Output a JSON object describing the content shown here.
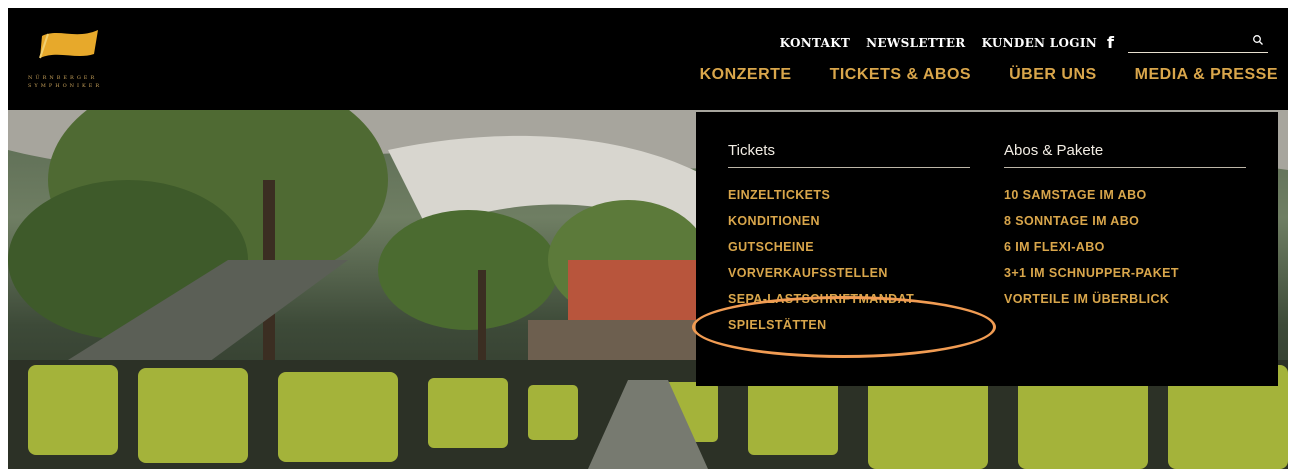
{
  "logo": {
    "text_line1": "NÜRNBERGER",
    "text_line2": "SYMPHONIKER",
    "icon": "flag-logo"
  },
  "top_links": {
    "kontakt": "KONTAKT",
    "newsletter": "NEWSLETTER",
    "kunden_login": "KUNDEN LOGIN",
    "facebook": "f"
  },
  "search": {
    "placeholder": "",
    "icon": "search-icon"
  },
  "main_nav": {
    "konzerte": "KONZERTE",
    "tickets_abos": "TICKETS & ABOS",
    "ueber_uns": "ÜBER UNS",
    "media_presse": "MEDIA & PRESSE"
  },
  "dropdown": {
    "tickets": {
      "heading": "Tickets",
      "items": [
        "EINZELTICKETS",
        "KONDITIONEN",
        "GUTSCHEINE",
        "VORVERKAUFSSTELLEN",
        "SEPA-LASTSCHRIFTMANDAT",
        "SPIELSTÄTTEN"
      ]
    },
    "abos": {
      "heading": "Abos & Pakete",
      "items": [
        "10 SAMSTAGE IM ABO",
        "8 SONNTAGE IM ABO",
        "6 IM FLEXI-ABO",
        "3+1 IM SCHNUPPER-PAKET",
        "VORTEILE IM ÜBERBLICK"
      ]
    }
  },
  "colors": {
    "accent": "#d9a64b",
    "highlight_ring": "#f19c53",
    "background": "#000000"
  }
}
